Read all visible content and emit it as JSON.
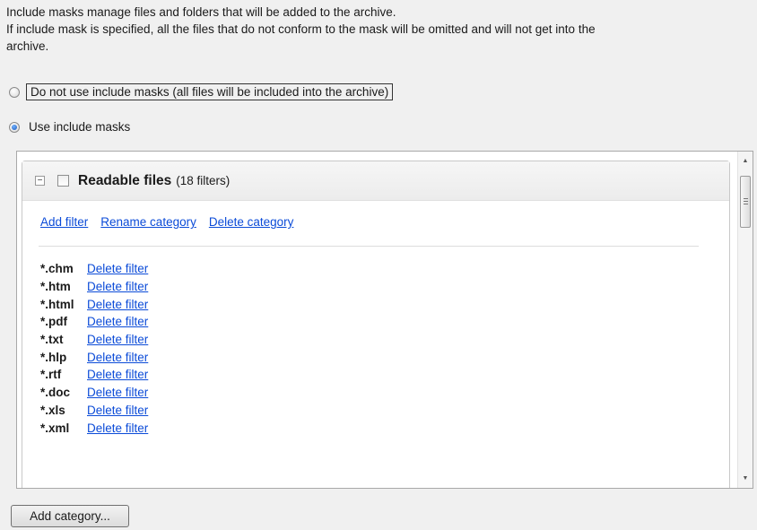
{
  "description": {
    "line1": "Include masks manage files and folders that will be added to the archive.",
    "line2": "If include mask is specified, all the files that do not conform to the mask will be omitted and will not get into the",
    "line3": "archive."
  },
  "options": {
    "no_masks_label": "Do not use include masks (all files will be included into the archive)",
    "use_masks_label": "Use include masks",
    "selected": "use_masks"
  },
  "category": {
    "name": "Readable files",
    "count_text": "(18 filters)",
    "checked": false,
    "expanded": true,
    "collapse_symbol": "−"
  },
  "actions": {
    "add_filter": "Add filter",
    "rename_category": "Rename category",
    "delete_category": "Delete category"
  },
  "filters": [
    {
      "mask": "*.chm",
      "action": "Delete filter"
    },
    {
      "mask": "*.htm",
      "action": "Delete filter"
    },
    {
      "mask": "*.html",
      "action": "Delete filter"
    },
    {
      "mask": "*.pdf",
      "action": "Delete filter"
    },
    {
      "mask": "*.txt",
      "action": "Delete filter"
    },
    {
      "mask": "*.hlp",
      "action": "Delete filter"
    },
    {
      "mask": "*.rtf",
      "action": "Delete filter"
    },
    {
      "mask": "*.doc",
      "action": "Delete filter"
    },
    {
      "mask": "*.xls",
      "action": "Delete filter"
    },
    {
      "mask": "*.xml",
      "action": "Delete filter"
    }
  ],
  "scrollbar": {
    "up_arrow": "▲",
    "down_arrow": "▼"
  },
  "buttons": {
    "add_category": "Add category..."
  },
  "colors": {
    "link": "#0b4bd8",
    "background": "#f0f0f0",
    "radio_checked": "#1d57b8"
  }
}
